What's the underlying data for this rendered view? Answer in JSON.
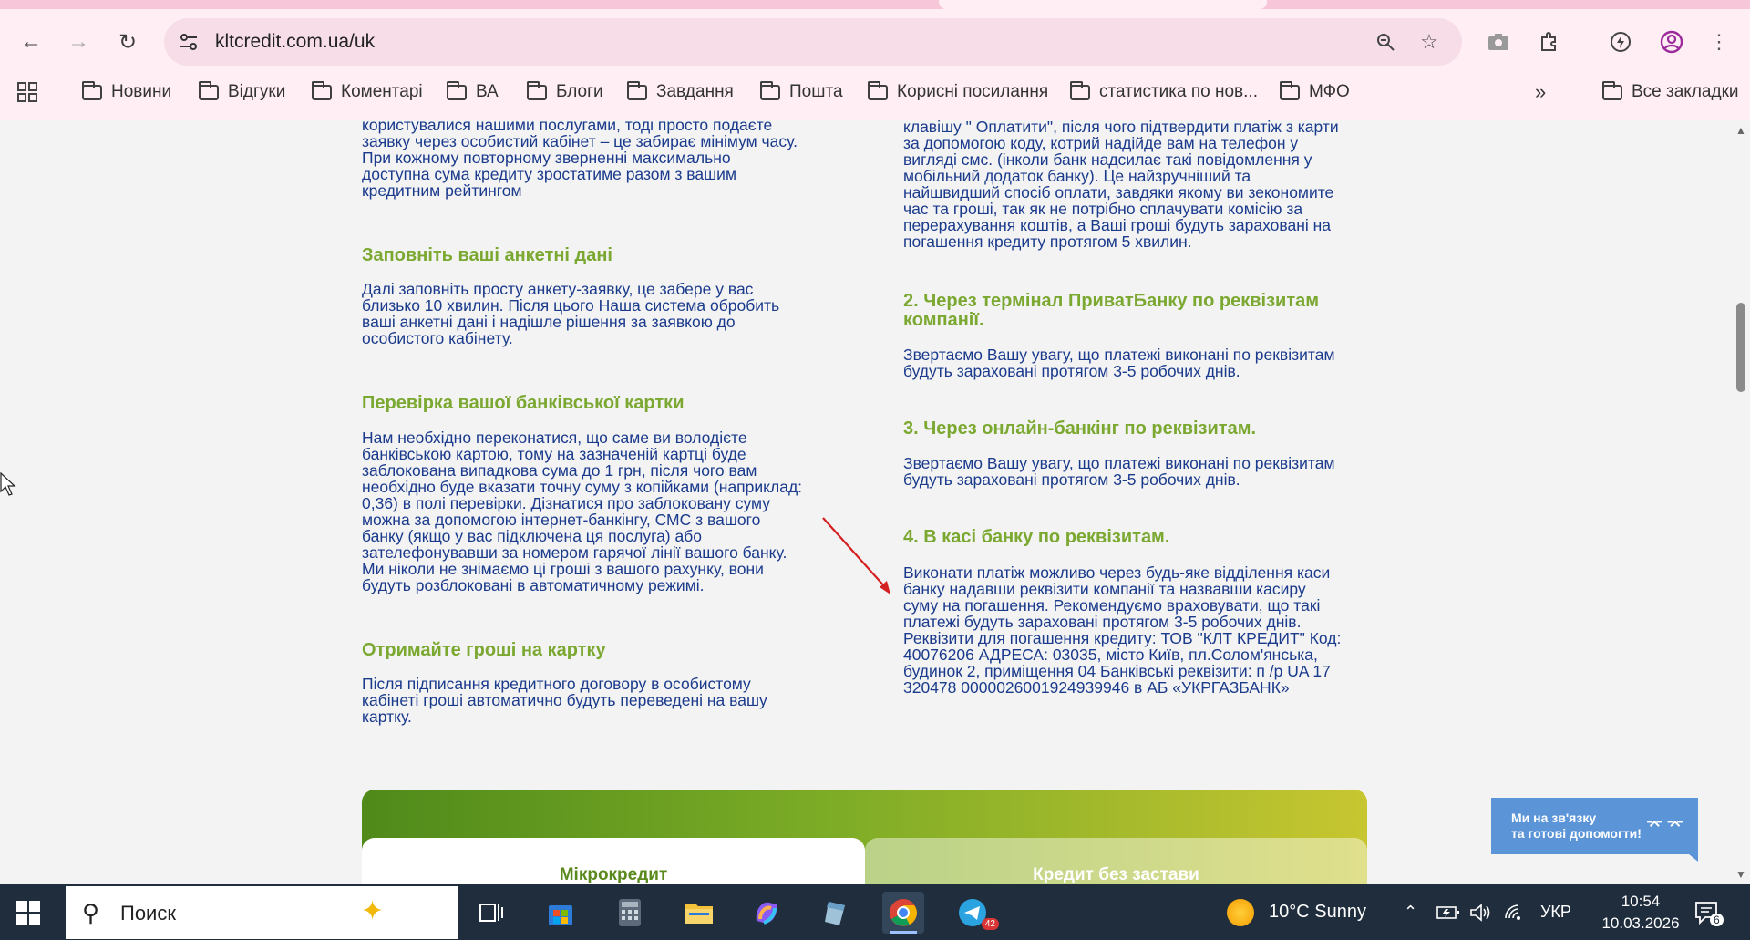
{
  "browser": {
    "url": "kltcredit.com.ua/uk",
    "bookmarks": [
      "Новини",
      "Відгуки",
      "Коментарі",
      "ВА",
      "Блоги",
      "Завдання",
      "Пошта",
      "Корисні посилання",
      "статистика по нов...",
      "МФО"
    ],
    "all_bookmarks_label": "Все закладки"
  },
  "left_column": {
    "intro_lines": [
      "користувалися нашими послугами, тоді просто подаєте",
      "заявку через особистий кабінет – це забирає мінімум часу.",
      "При кожному повторному зверненні максимально",
      "доступна сума кредиту зростатиме разом з вашим",
      "кредитним рейтингом"
    ],
    "section2_title": "Заповніть ваші анкетні дані",
    "section2_lines": [
      "Далі заповніть просту анкету-заявку, це забере у вас",
      "близько 10 хвилин. Після цього Наша система обробить",
      "ваші анкетні дані і надішле рішення за заявкою до",
      "особистого кабінету."
    ],
    "section3_title": "Перевірка вашої банківської картки",
    "section3_lines": [
      "Нам необхідно переконатися, що саме ви володієте",
      "банківською картою, тому на зазначеній картці буде",
      "заблокована випадкова сума до 1 грн, після чого вам",
      "необхідно буде вказати точну суму з копійками (наприклад:",
      "0,36) в полі перевірки. Дізнатися про заблоковану суму",
      "можна за допомогою інтернет-банкінгу, СМС з вашого",
      "банку (якщо у вас підключена ця послуга) або",
      "зателефонувавши за номером гарячої лінії вашого банку.",
      "Ми ніколи не знімаємо ці гроші з вашого рахунку, вони",
      "будуть розблоковані в автоматичному режимі."
    ],
    "section4_title": "Отримайте гроші на картку",
    "section4_lines": [
      "Після підписання кредитного договору в особистому",
      "кабінеті гроші автоматично будуть переведені на вашу",
      "картку."
    ]
  },
  "right_column": {
    "intro_lines": [
      "клавішу \" Оплатити\", після чого підтвердити платіж з карти",
      "за допомогою коду, котрий надійде вам на телефон у",
      "вигляді смс. (інколи банк надсилає такі повідомлення у",
      "мобільний додаток банку). Це найзручніший та",
      "найшвидший спосіб оплати, завдяки якому ви зекономите",
      "час та гроші, так як не потрібно сплачувати комісію за",
      "перерахування коштів, а Ваші гроші будуть зараховані на",
      "погашення кредиту протягом 5 хвилин."
    ],
    "method2_title_lines": [
      "2. Через термінал ПриватБанку по реквізитам",
      "компанії."
    ],
    "method2_lines": [
      "Звертаємо Вашу увагу, що платежі виконані по реквізитам",
      "будуть зараховані протягом 3-5 робочих днів."
    ],
    "method3_title": "3. Через онлайн-банкінг по реквізитам.",
    "method3_lines": [
      "Звертаємо Вашу увагу, що платежі виконані по реквізитам",
      "будуть зараховані протягом 3-5 робочих днів."
    ],
    "method4_title": "4. В касі банку по реквізитам.",
    "method4_lines": [
      "Виконати платіж можливо через будь-яке відділення каси",
      "банку надавши реквізити компанії та назвавши касиру",
      "суму на погашення. Рекомендуємо враховувати, що такі",
      "платежі будуть зараховані протягом 3-5 робочих днів.",
      "Реквізити для погашення кредиту: ТОВ \"КЛТ КРЕДИТ\" Код:",
      "40076206 АДРЕСА: 03035, місто Київ, пл.Солом'янська,",
      "будинок 2, приміщення 04 Банківські реквізити: п /р UA 17",
      "320478 0000026001924939946 в АБ «УКРГАЗБАНК»"
    ]
  },
  "promo": {
    "tab1": "Мікрокредит",
    "tab2": "Кредит без застави"
  },
  "chat": {
    "line1": "Ми на зв'язку",
    "line2": "та готові допомогти!"
  },
  "taskbar": {
    "search_placeholder": "Поиск",
    "weather": "10°C  Sunny",
    "lang": "УКР",
    "time": "10:54",
    "date": "10.03.2026",
    "telegram_badge": "42",
    "notif_count": "6"
  },
  "colors": {
    "heading_green": "#7ba831",
    "body_blue": "#1a3a8c",
    "arrow_red": "#d42020"
  }
}
